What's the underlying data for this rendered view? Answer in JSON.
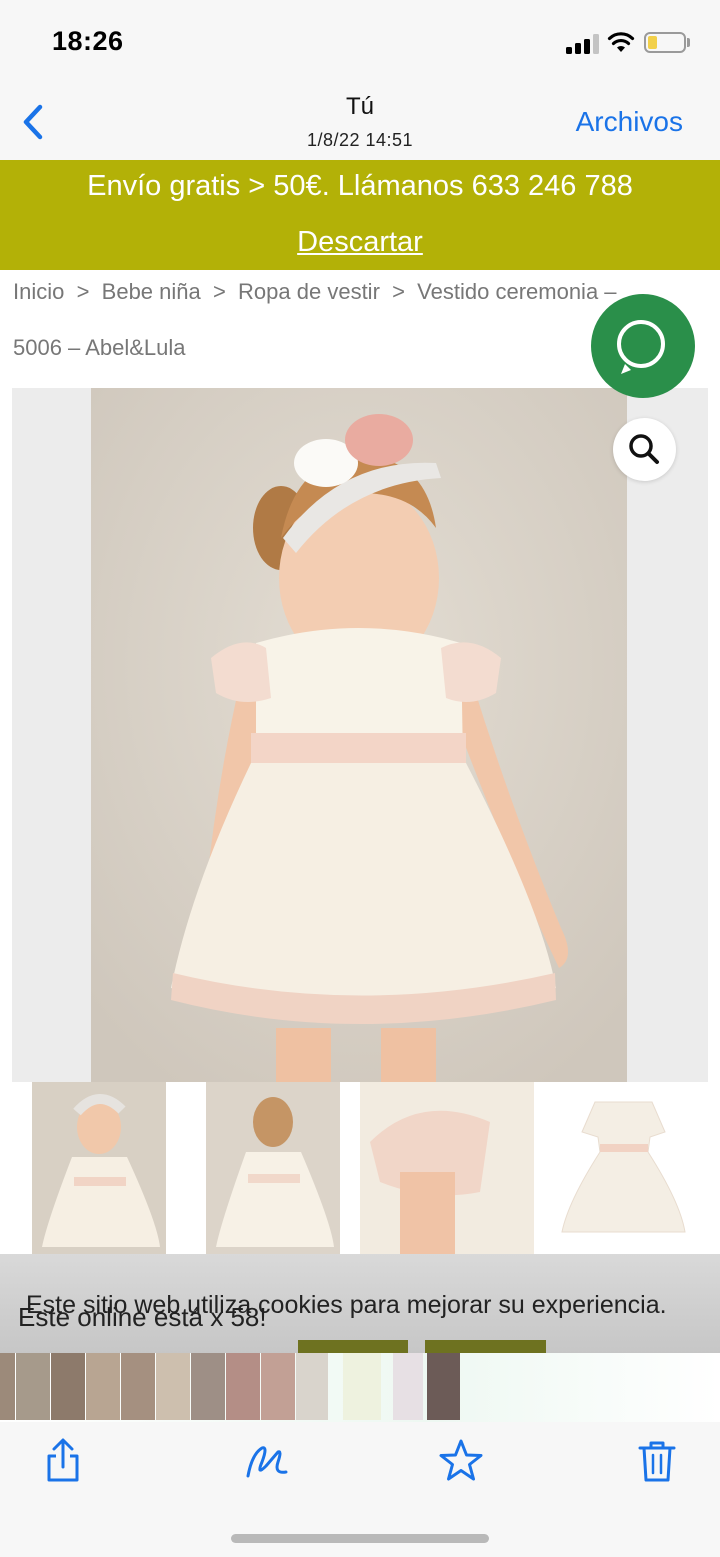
{
  "status_bar": {
    "time": "18:26"
  },
  "nav_bar": {
    "title": "Tú",
    "subtitle": "1/8/22 14:51",
    "right_action": "Archivos",
    "accent_color": "#1a73e8"
  },
  "screenshot": {
    "promo_banner": {
      "text": "Envío gratis > 50€. Llámanos 633 246 788",
      "dismiss_label": "Descartar",
      "background_color": "#b3b107"
    },
    "breadcrumb": {
      "line1": "Inicio  >  Bebe niña  >  Ropa de vestir  >  Vestido ceremonia –",
      "line2": "5006 – Abel&Lula"
    },
    "product_image": {
      "icon": "zoom-icon"
    },
    "thumbnails_count_visible": 4,
    "cookie_notice": {
      "text": "Este sitio web utiliza cookies para mejorar su experiencia.",
      "overlay_text": "Este online está x 58!"
    },
    "whatsapp": {
      "icon": "whatsapp-icon"
    }
  },
  "toolbar": {
    "share_icon": "share-icon",
    "markup_icon": "markup-icon",
    "favorite_icon": "star-icon",
    "delete_icon": "trash-icon"
  }
}
